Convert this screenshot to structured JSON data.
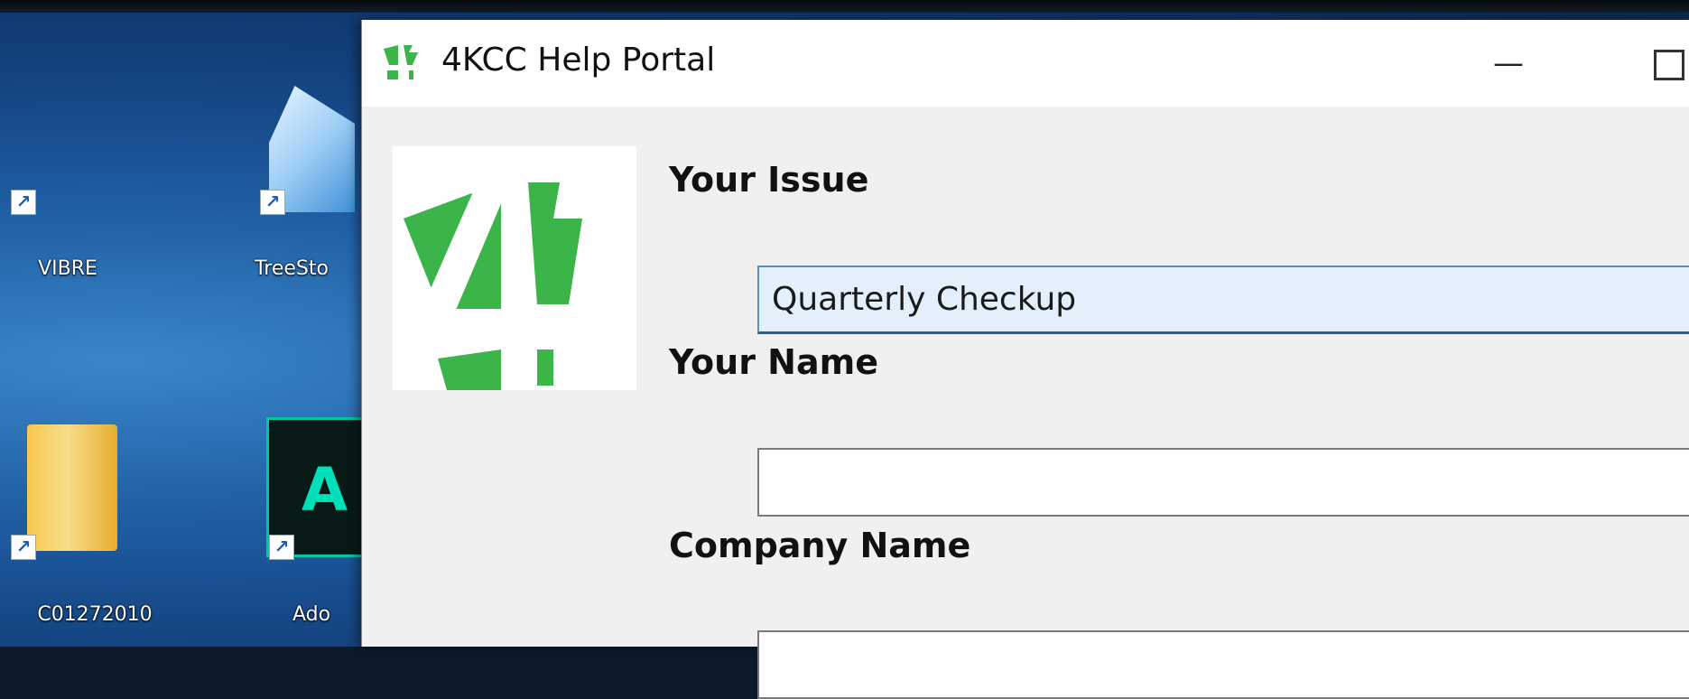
{
  "desktop": {
    "icons": [
      {
        "label": "VIBRE",
        "icon": "app-shortcut-icon"
      },
      {
        "label": "TreeSto",
        "icon": "cloud-app-icon"
      },
      {
        "label": "C01272010",
        "icon": "folder-icon"
      },
      {
        "label": "Ado",
        "icon": "adobe-app-icon"
      }
    ],
    "adobe_letter": "A"
  },
  "window": {
    "title": "4KCC Help Portal",
    "minimize_glyph": "—",
    "logo_color": "#3bb54a",
    "form": {
      "issue": {
        "label": "Your Issue",
        "value": "Quarterly Checkup"
      },
      "name": {
        "label": "Your Name",
        "value": ""
      },
      "company": {
        "label": "Company Name",
        "value": ""
      }
    }
  }
}
